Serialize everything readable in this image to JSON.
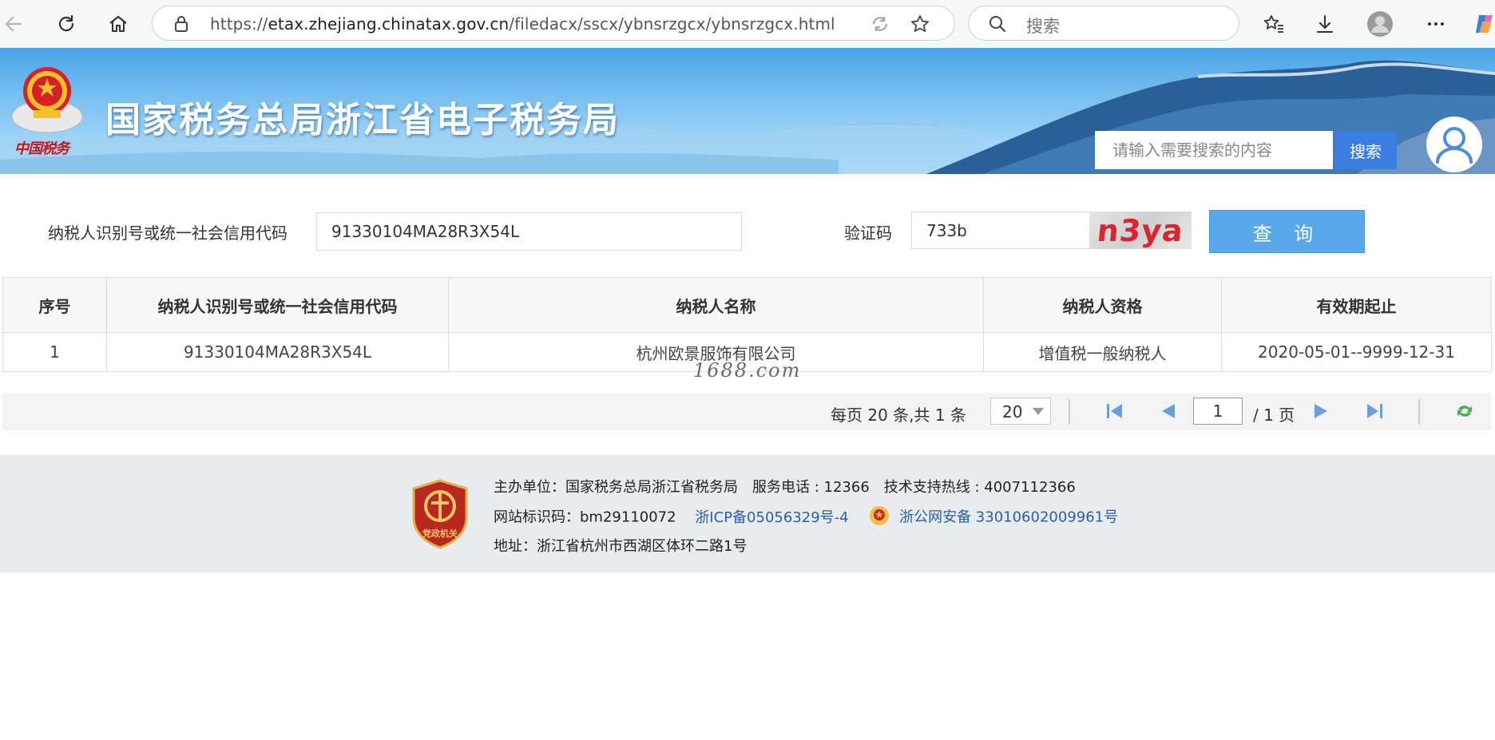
{
  "browser": {
    "url_prefix": "https://",
    "url_host": "etax.zhejiang.chinatax.gov.cn",
    "url_path": "/filedacx/sscx/ybnsrzgcx/ybnsrzgcx.html",
    "search_placeholder": "搜索"
  },
  "header": {
    "site_title": "国家税务总局浙江省电子税务局",
    "brand_script": "中国税务",
    "search_placeholder": "请输入需要搜索的内容",
    "search_button": "搜索",
    "login_label": "登录"
  },
  "query": {
    "code_label": "纳税人识别号或统一社会信用代码",
    "code_value": "91330104MA28R3X54L",
    "captcha_label": "验证码",
    "captcha_value": "733b",
    "captcha_image_text": "n3ya",
    "query_button": "查 询"
  },
  "table": {
    "columns": [
      "序号",
      "纳税人识别号或统一社会信用代码",
      "纳税人名称",
      "纳税人资格",
      "有效期起止"
    ],
    "rows": [
      [
        "1",
        "91330104MA28R3X54L",
        "杭州欧景服饰有限公司",
        "增值税一般纳税人",
        "2020-05-01--9999-12-31"
      ]
    ]
  },
  "watermark": "1688.com",
  "pager": {
    "info": "每页 20 条,共 1 条",
    "page_size": "20",
    "current_page": "1",
    "total_pages": "/ 1 页"
  },
  "footer": {
    "badge_text": "党政机关",
    "line1": "主办单位：国家税务总局浙江省税务局　服务电话 : 12366　技术支持热线 : 4007112366",
    "site_id": "网站标识码：bm29110072",
    "icp": "浙ICP备05056329号-4",
    "police": "浙公网安备 33010602009961号",
    "address": "地址：浙江省杭州市西湖区体环二路1号"
  },
  "colors": {
    "banner_sky": "#4aa3e6",
    "search_button": "#3a7fe0",
    "query_button": "#5aa8ec",
    "link": "#2a5fa8",
    "captcha_text": "#d8252f"
  }
}
